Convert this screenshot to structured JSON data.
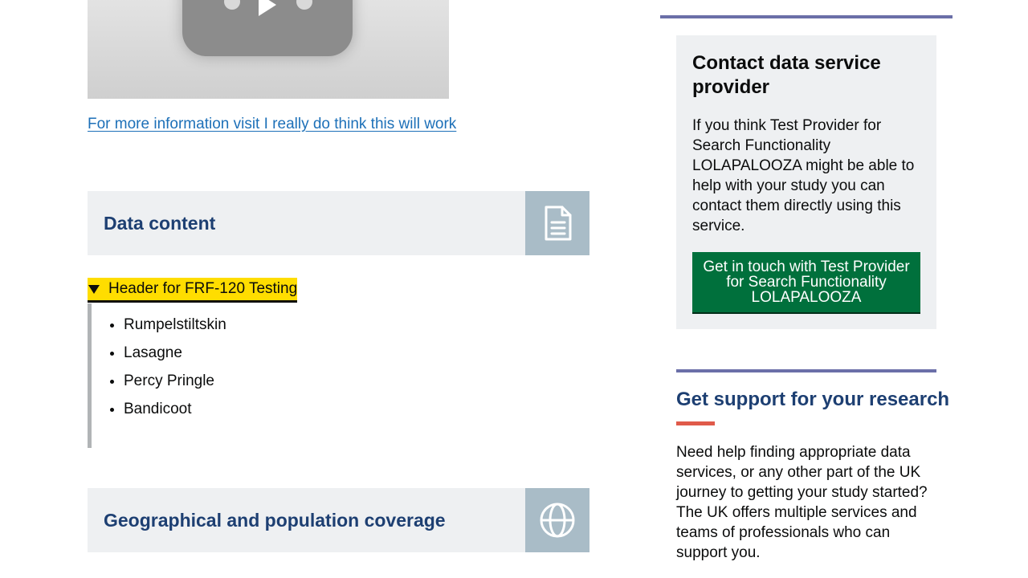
{
  "video": {
    "play_icon": "play-icon"
  },
  "more_info_link": "For more information visit I really do think this will work",
  "sections": {
    "data_content": {
      "title": "Data content",
      "icon": "document-icon"
    },
    "geo_coverage": {
      "title": "Geographical and population coverage",
      "icon": "globe-icon"
    }
  },
  "details": {
    "summary": "Header for FRF-120 Testing",
    "items": [
      "Rumpelstiltskin",
      "Lasagne",
      "Percy Pringle",
      "Bandicoot"
    ]
  },
  "contact": {
    "title": "Contact data service provider",
    "body": "If you think Test Provider for Search Functionality LOLAPALOOZA might be able to help with your study you can contact them directly using this service.",
    "button": "Get in touch with Test Provider for Search Functionality LOLAPALOOZA"
  },
  "support": {
    "title": "Get support for your research",
    "body": "Need help finding appropriate data services, or any other part of the UK journey to getting your study started? The UK offers multiple services and teams of professionals who can support you."
  },
  "colors": {
    "heading_blue": "#1d3f72",
    "link_blue": "#1d70b8",
    "button_green": "#00703c",
    "focus_yellow": "#ffdd00",
    "rule_purple": "#6b6fa8",
    "accent_red": "#e05a4a"
  }
}
